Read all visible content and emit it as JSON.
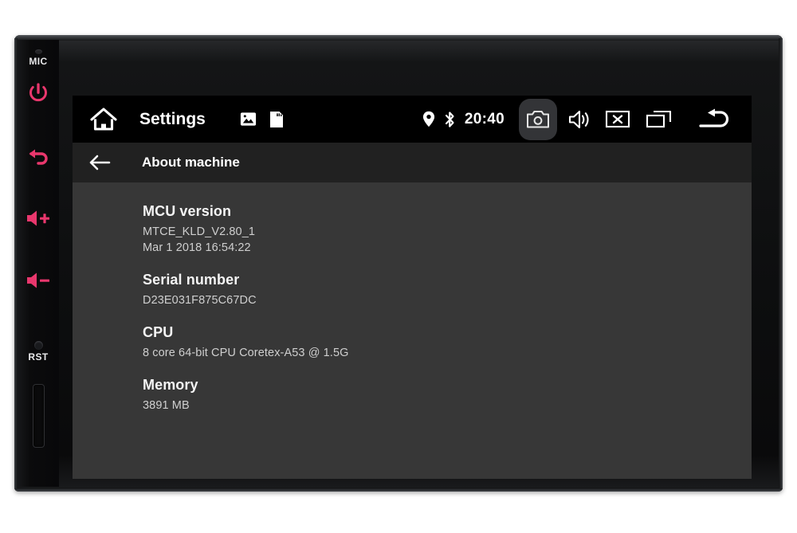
{
  "device": {
    "left_panel": {
      "mic_label": "MIC",
      "reset_label": "RST",
      "buttons": [
        {
          "name": "power",
          "icon": "power-icon"
        },
        {
          "name": "back",
          "icon": "back-arrow-icon"
        },
        {
          "name": "volume-up",
          "icon": "volume-up-icon"
        },
        {
          "name": "volume-down",
          "icon": "volume-down-icon"
        }
      ],
      "sd_slot_label": "sd-card-slot"
    }
  },
  "screen": {
    "topbar": {
      "home_icon": "home-icon",
      "app_title": "Settings",
      "app_icons": [
        {
          "name": "gallery-icon",
          "label": "Gallery"
        },
        {
          "name": "sd-card-icon",
          "label": "SD Card"
        }
      ],
      "status": {
        "location_icon": "location-pin-icon",
        "bluetooth_icon": "bluetooth-icon",
        "clock": "20:40"
      },
      "nav_keys": [
        {
          "name": "screenshot-button",
          "icon": "camera-icon",
          "active": true
        },
        {
          "name": "volume-button",
          "icon": "speaker-icon",
          "active": false
        },
        {
          "name": "close-button",
          "icon": "close-box-icon",
          "active": false
        },
        {
          "name": "recents-button",
          "icon": "recents-icon",
          "active": false
        },
        {
          "name": "back-button",
          "icon": "back-curve-icon",
          "active": false
        }
      ]
    },
    "subheader": {
      "back_icon": "arrow-left-icon",
      "title": "About machine"
    },
    "list": [
      {
        "title": "MCU version",
        "lines": [
          "MTCE_KLD_V2.80_1",
          "Mar  1 2018 16:54:22"
        ]
      },
      {
        "title": "Serial number",
        "lines": [
          "D23E031F875C67DC"
        ]
      },
      {
        "title": "CPU",
        "lines": [
          "8 core 64-bit CPU Coretex-A53 @ 1.5G"
        ]
      },
      {
        "title": "Memory",
        "lines": [
          "3891 MB"
        ]
      }
    ]
  },
  "colors": {
    "accent_pink": "#e9376d",
    "screen_bg": "#373737",
    "header_bg": "#212121",
    "topbar_bg": "#000000",
    "active_key_bg": "#333437",
    "text_primary": "#f4f4f4",
    "text_secondary": "#cfcfcf"
  }
}
